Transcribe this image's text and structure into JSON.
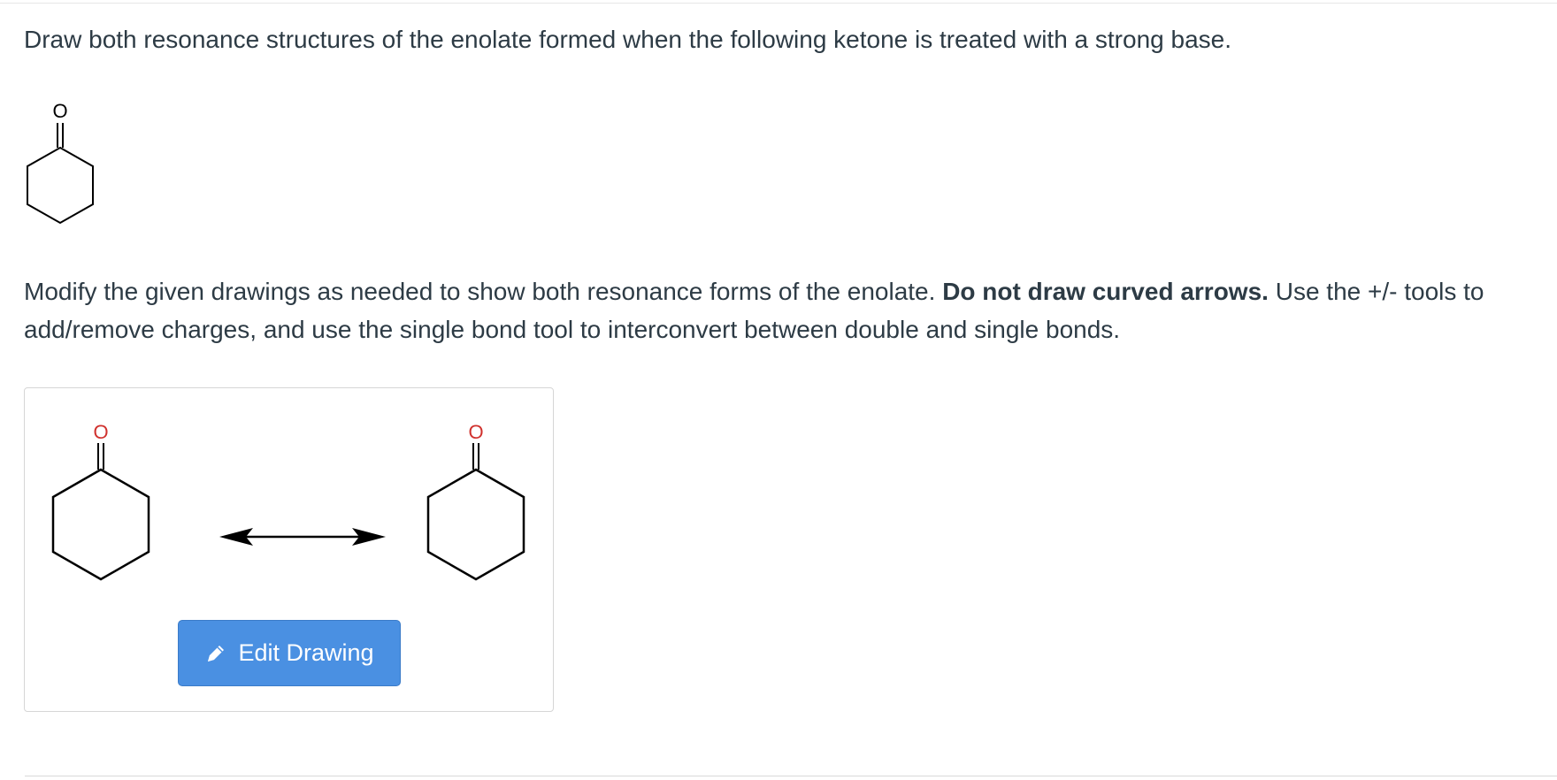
{
  "question": {
    "prompt": "Draw both resonance structures of the enolate formed when the following ketone is treated with a strong base."
  },
  "ketone": {
    "atom_label": "O"
  },
  "instructions": {
    "part1": "Modify the given drawings as needed to show both resonance forms of the enolate. ",
    "bold": "Do not draw curved arrows.",
    "part2": " Use the +/- tools to add/remove charges, and use the single bond tool to interconvert between double and single bonds."
  },
  "drawing": {
    "left_atom_label": "O",
    "right_atom_label": "O",
    "oxygen_color": "#d0312d",
    "bond_color": "#000000",
    "edit_button_label": "Edit Drawing",
    "edit_button_icon": "pencil-icon",
    "button_color": "#4a90e2"
  }
}
